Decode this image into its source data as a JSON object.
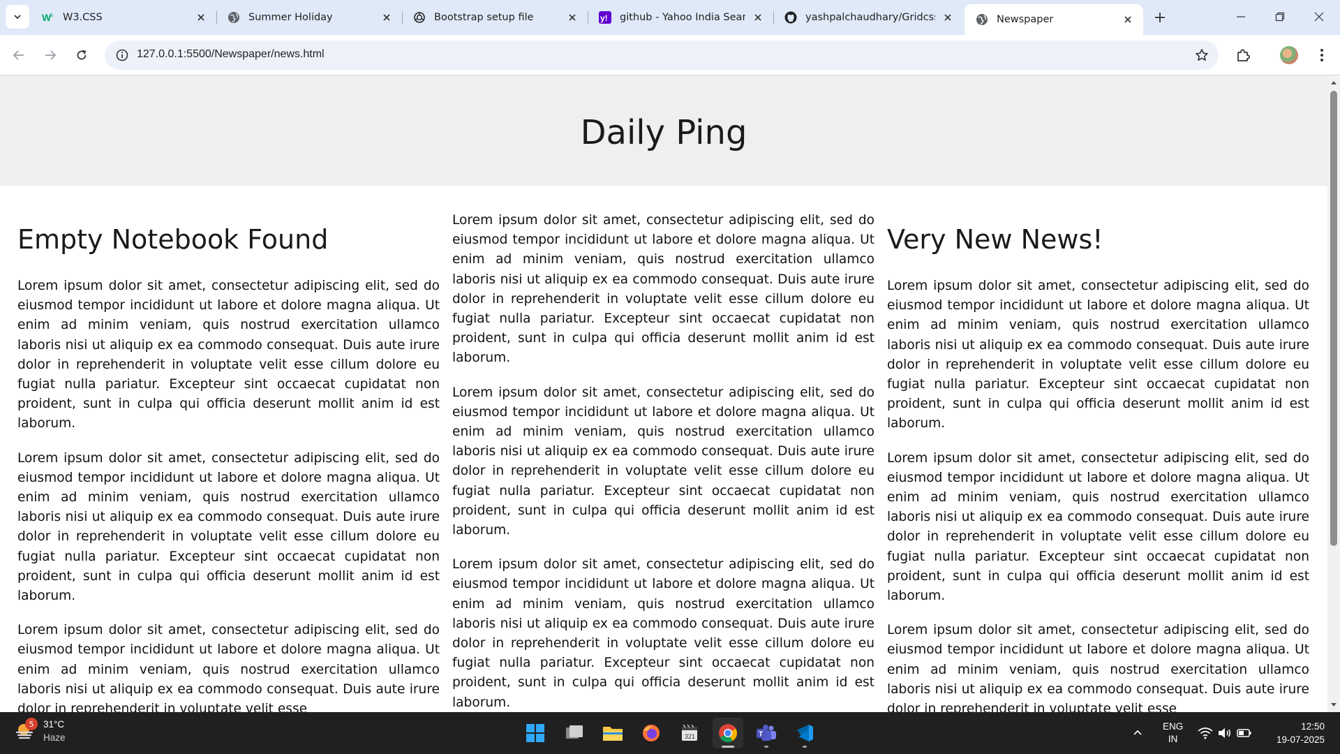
{
  "browser": {
    "tabs": [
      {
        "title": "W3.CSS",
        "icon": "w3schools-icon"
      },
      {
        "title": "Summer Holiday",
        "icon": "globe-icon"
      },
      {
        "title": "Bootstrap setup file",
        "icon": "openai-icon"
      },
      {
        "title": "github - Yahoo India Search",
        "icon": "yahoo-icon"
      },
      {
        "title": "yashpalchaudhary/Gridcss",
        "icon": "github-icon"
      },
      {
        "title": "Newspaper",
        "icon": "globe-icon",
        "active": true
      }
    ],
    "url": "127.0.0.1:5500/Newspaper/news.html"
  },
  "page": {
    "masthead": "Daily Ping",
    "left": {
      "heading": "Empty Notebook Found",
      "paragraphs": [
        "Lorem ipsum dolor sit amet, consectetur adipiscing elit, sed do eiusmod tempor incididunt ut labore et dolore magna aliqua. Ut enim ad minim veniam, quis nostrud exercitation ullamco laboris nisi ut aliquip ex ea commodo consequat. Duis aute irure dolor in reprehenderit in voluptate velit esse cillum dolore eu fugiat nulla pariatur. Excepteur sint occaecat cupidatat non proident, sunt in culpa qui officia deserunt mollit anim id est laborum.",
        "Lorem ipsum dolor sit amet, consectetur adipiscing elit, sed do eiusmod tempor incididunt ut labore et dolore magna aliqua. Ut enim ad minim veniam, quis nostrud exercitation ullamco laboris nisi ut aliquip ex ea commodo consequat. Duis aute irure dolor in reprehenderit in voluptate velit esse cillum dolore eu fugiat nulla pariatur. Excepteur sint occaecat cupidatat non proident, sunt in culpa qui officia deserunt mollit anim id est laborum.",
        "Lorem ipsum dolor sit amet, consectetur adipiscing elit, sed do eiusmod tempor incididunt ut labore et dolore magna aliqua. Ut enim ad minim veniam, quis nostrud exercitation ullamco laboris nisi ut aliquip ex ea commodo consequat. Duis aute irure dolor in reprehenderit in voluptate velit esse"
      ]
    },
    "middle": {
      "paragraphs": [
        "Lorem ipsum dolor sit amet, consectetur adipiscing elit, sed do eiusmod tempor incididunt ut labore et dolore magna aliqua. Ut enim ad minim veniam, quis nostrud exercitation ullamco laboris nisi ut aliquip ex ea commodo consequat. Duis aute irure dolor in reprehenderit in voluptate velit esse cillum dolore eu fugiat nulla pariatur. Excepteur sint occaecat cupidatat non proident, sunt in culpa qui officia deserunt mollit anim id est laborum.",
        "Lorem ipsum dolor sit amet, consectetur adipiscing elit, sed do eiusmod tempor incididunt ut labore et dolore magna aliqua. Ut enim ad minim veniam, quis nostrud exercitation ullamco laboris nisi ut aliquip ex ea commodo consequat. Duis aute irure dolor in reprehenderit in voluptate velit esse cillum dolore eu fugiat nulla pariatur. Excepteur sint occaecat cupidatat non proident, sunt in culpa qui officia deserunt mollit anim id est laborum.",
        "Lorem ipsum dolor sit amet, consectetur adipiscing elit, sed do eiusmod tempor incididunt ut labore et dolore magna aliqua. Ut enim ad minim veniam, quis nostrud exercitation ullamco laboris nisi ut aliquip ex ea commodo consequat. Duis aute irure dolor in reprehenderit in voluptate velit esse cillum dolore eu fugiat nulla pariatur. Excepteur sint occaecat cupidatat non proident, sunt in culpa qui officia deserunt mollit anim id est laborum."
      ]
    },
    "right": {
      "heading": "Very New News!",
      "paragraphs": [
        "Lorem ipsum dolor sit amet, consectetur adipiscing elit, sed do eiusmod tempor incididunt ut labore et dolore magna aliqua. Ut enim ad minim veniam, quis nostrud exercitation ullamco laboris nisi ut aliquip ex ea commodo consequat. Duis aute irure dolor in reprehenderit in voluptate velit esse cillum dolore eu fugiat nulla pariatur. Excepteur sint occaecat cupidatat non proident, sunt in culpa qui officia deserunt mollit anim id est laborum.",
        "Lorem ipsum dolor sit amet, consectetur adipiscing elit, sed do eiusmod tempor incididunt ut labore et dolore magna aliqua. Ut enim ad minim veniam, quis nostrud exercitation ullamco laboris nisi ut aliquip ex ea commodo consequat. Duis aute irure dolor in reprehenderit in voluptate velit esse cillum dolore eu fugiat nulla pariatur. Excepteur sint occaecat cupidatat non proident, sunt in culpa qui officia deserunt mollit anim id est laborum.",
        "Lorem ipsum dolor sit amet, consectetur adipiscing elit, sed do eiusmod tempor incididunt ut labore et dolore magna aliqua. Ut enim ad minim veniam, quis nostrud exercitation ullamco laboris nisi ut aliquip ex ea commodo consequat. Duis aute irure dolor in reprehenderit in voluptate velit esse"
      ]
    }
  },
  "taskbar": {
    "weather": {
      "temp": "31°C",
      "condition": "Haze",
      "badge": "5"
    },
    "apps": [
      "windows-start-icon",
      "task-view-icon",
      "file-explorer-icon",
      "firefox-icon",
      "calendar-app-icon",
      "chrome-icon",
      "teams-icon",
      "vscode-icon"
    ],
    "language": {
      "line1": "ENG",
      "line2": "IN"
    },
    "clock": {
      "time": "12:50",
      "date": "19-07-2025"
    }
  },
  "colors": {
    "tabstrip": "#dfe9f7",
    "omnibox": "#edf2fa",
    "masthead": "#efefef",
    "taskbar": "#202020"
  }
}
